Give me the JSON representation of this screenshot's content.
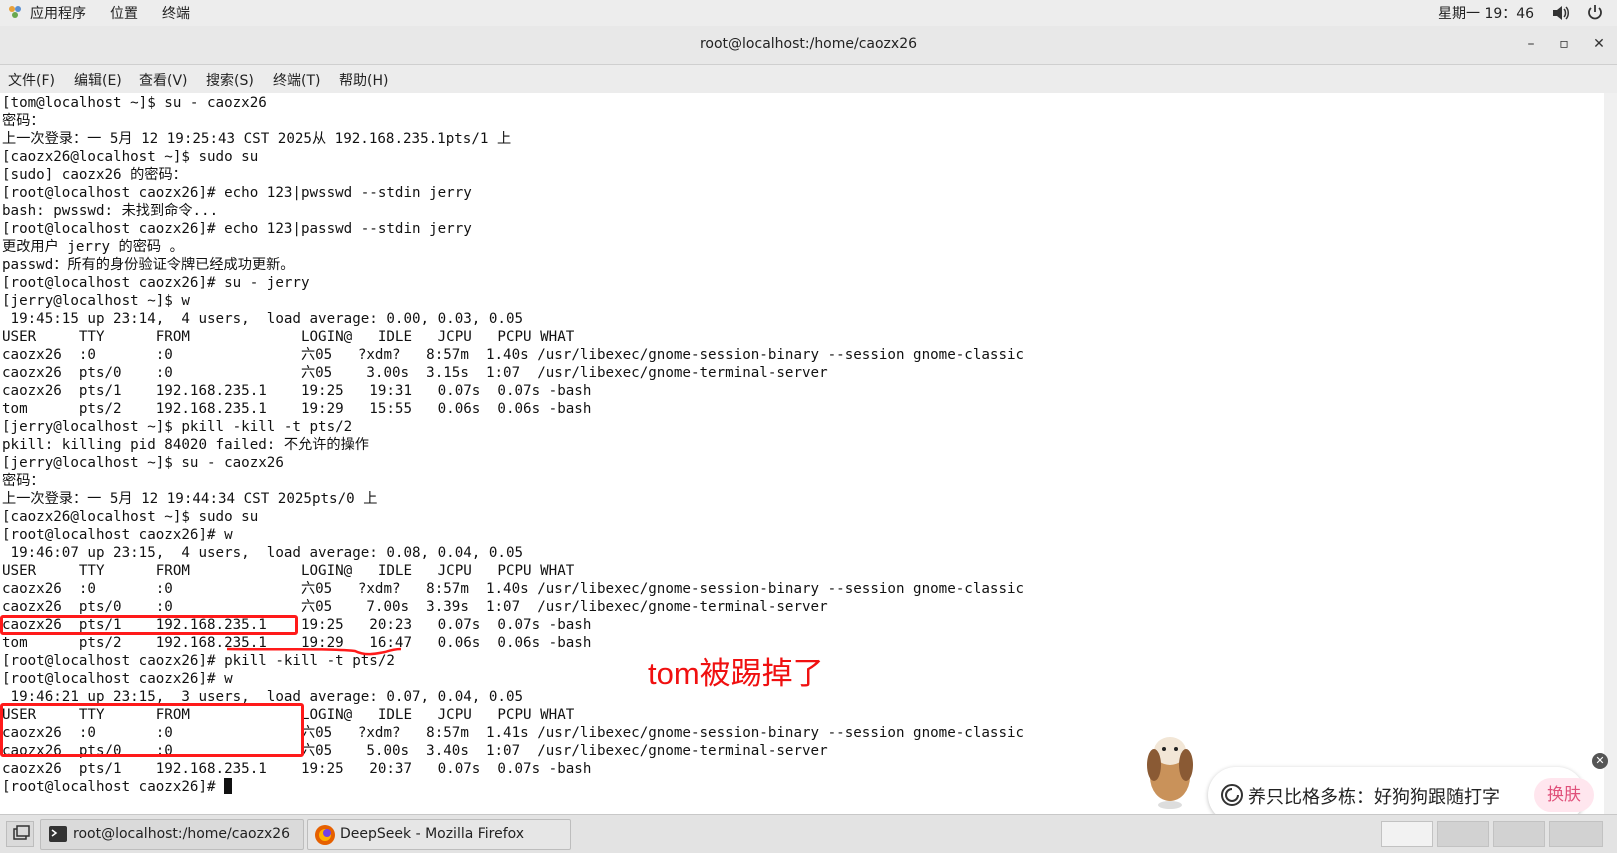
{
  "topbar": {
    "apps_label": "应用程序",
    "places_label": "位置",
    "terminal_label": "终端",
    "clock": "星期一 19：46",
    "icons": [
      "apps-icon",
      "volume-icon",
      "power-icon"
    ]
  },
  "window": {
    "title": "root@localhost:/home/caozx26",
    "minimize": "–",
    "maximize": "▫",
    "close": "✕"
  },
  "menubar": {
    "file": "文件(F)",
    "edit": "编辑(E)",
    "view": "查看(V)",
    "search": "搜索(S)",
    "terminal": "终端(T)",
    "help": "帮助(H)"
  },
  "terminal": {
    "lines": [
      "[tom@localhost ~]$ su - caozx26",
      "密码：",
      "上一次登录：一 5月 12 19:25:43 CST 2025从 192.168.235.1pts/1 上",
      "[caozx26@localhost ~]$ sudo su",
      "[sudo] caozx26 的密码：",
      "[root@localhost caozx26]# echo 123|pwsswd --stdin jerry",
      "bash: pwsswd: 未找到命令...",
      "[root@localhost caozx26]# echo 123|passwd --stdin jerry",
      "更改用户 jerry 的密码 。",
      "passwd：所有的身份验证令牌已经成功更新。",
      "[root@localhost caozx26]# su - jerry",
      "[jerry@localhost ~]$ w",
      " 19:45:15 up 23:14,  4 users,  load average: 0.00, 0.03, 0.05",
      "USER     TTY      FROM             LOGIN@   IDLE   JCPU   PCPU WHAT",
      "caozx26  :0       :0               六05   ?xdm?   8:57m  1.40s /usr/libexec/gnome-session-binary --session gnome-classic",
      "caozx26  pts/0    :0               六05    3.00s  3.15s  1:07  /usr/libexec/gnome-terminal-server",
      "caozx26  pts/1    192.168.235.1    19:25   19:31   0.07s  0.07s -bash",
      "tom      pts/2    192.168.235.1    19:29   15:55   0.06s  0.06s -bash",
      "[jerry@localhost ~]$ pkill -kill -t pts/2",
      "pkill: killing pid 84020 failed: 不允许的操作",
      "[jerry@localhost ~]$ su - caozx26",
      "密码：",
      "上一次登录：一 5月 12 19:44:34 CST 2025pts/0 上",
      "[caozx26@localhost ~]$ sudo su",
      "[root@localhost caozx26]# w",
      " 19:46:07 up 23:15,  4 users,  load average: 0.08, 0.04, 0.05",
      "USER     TTY      FROM             LOGIN@   IDLE   JCPU   PCPU WHAT",
      "caozx26  :0       :0               六05   ?xdm?   8:57m  1.40s /usr/libexec/gnome-session-binary --session gnome-classic",
      "caozx26  pts/0    :0               六05    7.00s  3.39s  1:07  /usr/libexec/gnome-terminal-server",
      "caozx26  pts/1    192.168.235.1    19:25   20:23   0.07s  0.07s -bash",
      "tom      pts/2    192.168.235.1    19:29   16:47   0.06s  0.06s -bash",
      "[root@localhost caozx26]# pkill -kill -t pts/2",
      "[root@localhost caozx26]# w",
      " 19:46:21 up 23:15,  3 users,  load average: 0.07, 0.04, 0.05",
      "USER     TTY      FROM             LOGIN@   IDLE   JCPU   PCPU WHAT",
      "caozx26  :0       :0               六05   ?xdm?   8:57m  1.41s /usr/libexec/gnome-session-binary --session gnome-classic",
      "caozx26  pts/0    :0               六05    5.00s  3.40s  1:07  /usr/libexec/gnome-terminal-server",
      "caozx26  pts/1    192.168.235.1    19:25   20:37   0.07s  0.07s -bash"
    ],
    "prompt": "[root@localhost caozx26]# "
  },
  "annotation": {
    "text": "tom被踢掉了",
    "color": "#f01010"
  },
  "taskbar": {
    "items": [
      {
        "label": "root@localhost:/home/caozx26",
        "icon": "terminal-icon"
      },
      {
        "label": "DeepSeek - Mozilla Firefox",
        "icon": "firefox-icon"
      }
    ]
  },
  "popup": {
    "message": "养只比格多栋：好狗狗跟随打字",
    "skin_button": "换肤"
  }
}
